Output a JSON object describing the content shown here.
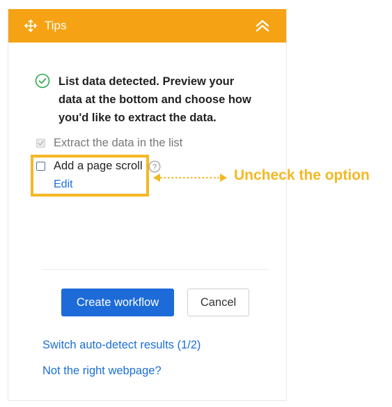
{
  "header": {
    "title": "Tips",
    "background_color": "#f5a315",
    "move_icon": "move-arrows-icon",
    "collapse_icon": "double-chevron-up-icon"
  },
  "detection": {
    "icon": "check-circle-icon",
    "message": "List data detected. Preview your data at the bottom and choose how you'd like to extract the data."
  },
  "options": {
    "extract_list": {
      "label": "Extract the data in the list",
      "checked": true,
      "disabled": true
    },
    "page_scroll": {
      "label": "Add a page scroll",
      "checked": false,
      "help_icon": "question-circle-icon",
      "edit_label": "Edit"
    }
  },
  "annotation": {
    "text": "Uncheck the option",
    "color": "#f5b823"
  },
  "buttons": {
    "create_workflow": "Create workflow",
    "cancel": "Cancel",
    "primary_color": "#1c6bd8"
  },
  "links": {
    "switch_results": "Switch auto-detect results (1/2)",
    "wrong_page": "Not the right webpage?"
  }
}
